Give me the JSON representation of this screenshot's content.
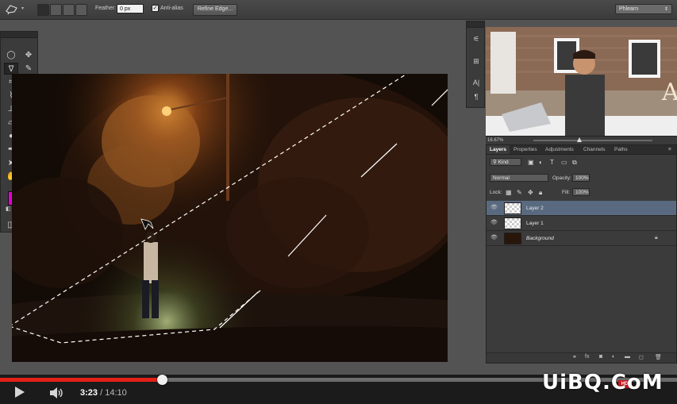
{
  "options_bar": {
    "feather_label": "Feather:",
    "feather_value": "0 px",
    "antialias_label": "Anti-alias",
    "antialias_checked": true,
    "refine_edge_label": "Refine Edge...",
    "workspace_value": "Phlearn"
  },
  "tools": {
    "foreground_color": "#e100d4",
    "background_color": "#ffffff",
    "selected_tool": "polygonal-lasso"
  },
  "layers_panel": {
    "tabs": [
      "Layers",
      "Properties",
      "Adjustments",
      "Channels",
      "Paths"
    ],
    "active_tab": "Layers",
    "filter_kind": "Kind",
    "blend_mode": "Normal",
    "opacity_label": "Opacity:",
    "opacity_value": "100%",
    "lock_label": "Lock:",
    "fill_label": "Fill:",
    "fill_value": "100%",
    "layers": [
      {
        "name": "Layer 2",
        "selected": true,
        "thumb": "transparent"
      },
      {
        "name": "Layer 1",
        "selected": false,
        "thumb": "transparent"
      },
      {
        "name": "Background",
        "selected": false,
        "thumb": "photo",
        "locked": true
      }
    ]
  },
  "zoom": "16.67%",
  "player": {
    "current_time": "3:23",
    "separator": " / ",
    "total_time": "14:10",
    "progress": 0.2389,
    "hd_badge": "HD"
  },
  "watermark": "UiBQ.CoM",
  "colors": {
    "accent_progress": "#e52117",
    "selected_layer": "#596a80",
    "panel_bg": "#3b3b3b"
  }
}
